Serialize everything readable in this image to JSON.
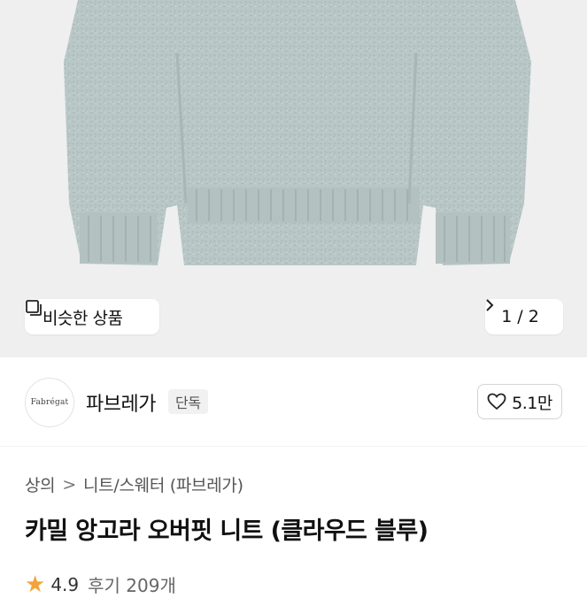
{
  "hero": {
    "similar_label": "비슷한 상품",
    "page_current": "1",
    "page_separator": "/",
    "page_total": "2"
  },
  "brand": {
    "logo_text": "Fabrégat",
    "name": "파브레가",
    "badge": "단독",
    "likes": "5.1만"
  },
  "breadcrumb": {
    "category": "상의",
    "separator": ">",
    "subcategory": "니트/스웨터 (파브레가)"
  },
  "product": {
    "title": "카밀 앙고라 오버핏 니트 (클라우드 블루)"
  },
  "rating": {
    "score": "4.9",
    "reviews": "후기 209개"
  },
  "colors": {
    "sweater": "#b9c7c7",
    "hero_bg": "#efefef",
    "star": "#f3a33a"
  }
}
